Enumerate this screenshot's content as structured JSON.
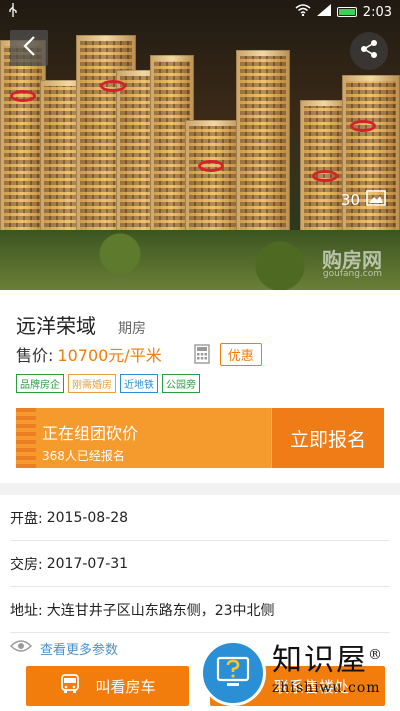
{
  "status_bar": {
    "usb_icon": "usb-icon",
    "time": "2:03"
  },
  "hero": {
    "photo_count": "30",
    "watermark": "购房网",
    "watermark_url": "goufang.com"
  },
  "property": {
    "name": "远洋荣域",
    "phase": "期房",
    "price_label": "售价:",
    "price_value": "10700元/平米",
    "discount": "优惠",
    "tags": [
      "品牌房企",
      "刚需婚房",
      "近地铁",
      "公园旁"
    ]
  },
  "group_buy": {
    "title": "正在组团砍价",
    "subtitle": "368人已经报名",
    "signup": "立即报名"
  },
  "details": [
    {
      "label": "开盘:",
      "value": "2015-08-28"
    },
    {
      "label": "交房:",
      "value": "2017-07-31"
    },
    {
      "label": "地址:",
      "value": "大连甘井子区山东路东侧，23中北侧"
    }
  ],
  "more": "查看更多参数",
  "bottom": {
    "call_car": "叫看房车",
    "contact": "联系售楼处"
  },
  "overlay": {
    "name": "知识屋",
    "reg": "®",
    "url": "zhishiwu.com"
  },
  "colors": {
    "accent": "#f27d0c",
    "link": "#4a90c8"
  }
}
